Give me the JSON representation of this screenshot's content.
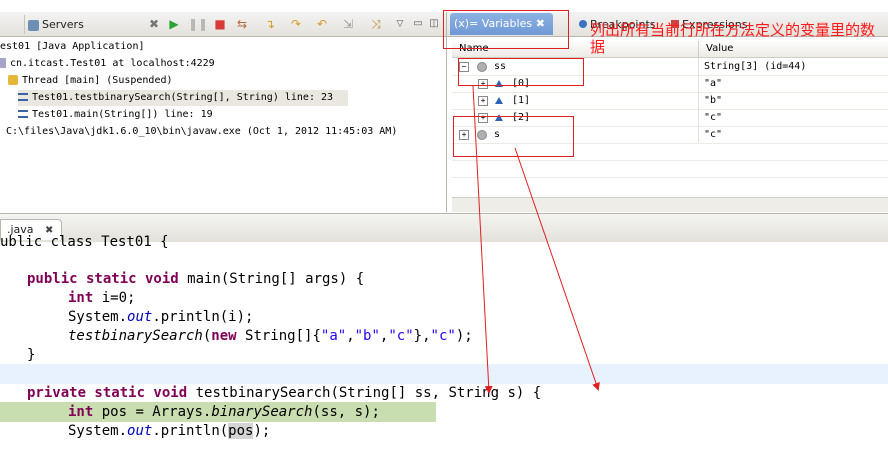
{
  "debug": {
    "tabs": [
      {
        "label": "Servers"
      }
    ],
    "tree": [
      {
        "text": "est01 [Java Application]"
      },
      {
        "text": "cn.itcast.Test01 at localhost:4229"
      },
      {
        "text": "Thread [main] (Suspended)"
      },
      {
        "text": "Test01.testbinarySearch(String[], String) line: 23"
      },
      {
        "text": "Test01.main(String[]) line: 19"
      },
      {
        "text": "C:\\files\\Java\\jdk1.6.0_10\\bin\\javaw.exe (Oct 1, 2012 11:45:03 AM)"
      }
    ]
  },
  "variables": {
    "tabs": {
      "variables": "(x)= Variables",
      "breakpoints": "Breakpoints",
      "expressions": "Expressions"
    },
    "columns": {
      "name": "Name",
      "value": "Value"
    },
    "rows": [
      {
        "name": "ss",
        "value": "String[3]  (id=44)"
      },
      {
        "name": "[0]",
        "value": "\"a\""
      },
      {
        "name": "[1]",
        "value": "\"b\""
      },
      {
        "name": "[2]",
        "value": "\"c\""
      },
      {
        "name": "s",
        "value": "\"c\""
      }
    ]
  },
  "annotation": {
    "text": "列出所有当前行所在方法定义的变量里的数据"
  },
  "editor": {
    "tab": ".java",
    "lines": [
      {
        "text": "ublic class Test01 {"
      },
      {
        "text": ""
      },
      {
        "kw1": "public static void",
        "rest": " main(String[] args) {"
      },
      {
        "kw1": "int",
        "rest": " i=0;"
      },
      {
        "a": "System.",
        "f": "out",
        "b": ".println(i);"
      },
      {
        "m": "testbinarySearch",
        "a": "(",
        "kw": "new",
        "b": " String[]{",
        "s1": "\"a\"",
        "c1": ",",
        "s2": "\"b\"",
        "c2": ",",
        "s3": "\"c\"",
        "c3": "},",
        "s4": "\"c\"",
        "e": ");"
      },
      {
        "text": "}"
      },
      {
        "text": ""
      },
      {
        "kw1": "private static void",
        "rest": " testbinarySearch(String[] ss, String s) {"
      },
      {
        "kw1": "int",
        "a": " pos = Arrays.",
        "m": "binarySearch",
        "b": "(ss, s);"
      },
      {
        "a": "System.",
        "f": "out",
        "b": ".println(",
        "h": "pos",
        "e": ");"
      }
    ]
  },
  "colors": {
    "annotation": "#ff1a1a",
    "keyword": "#7f0055",
    "string": "#2a00ff",
    "current_line": "#c8deb0",
    "selected_tab": "#7ba3dc"
  }
}
